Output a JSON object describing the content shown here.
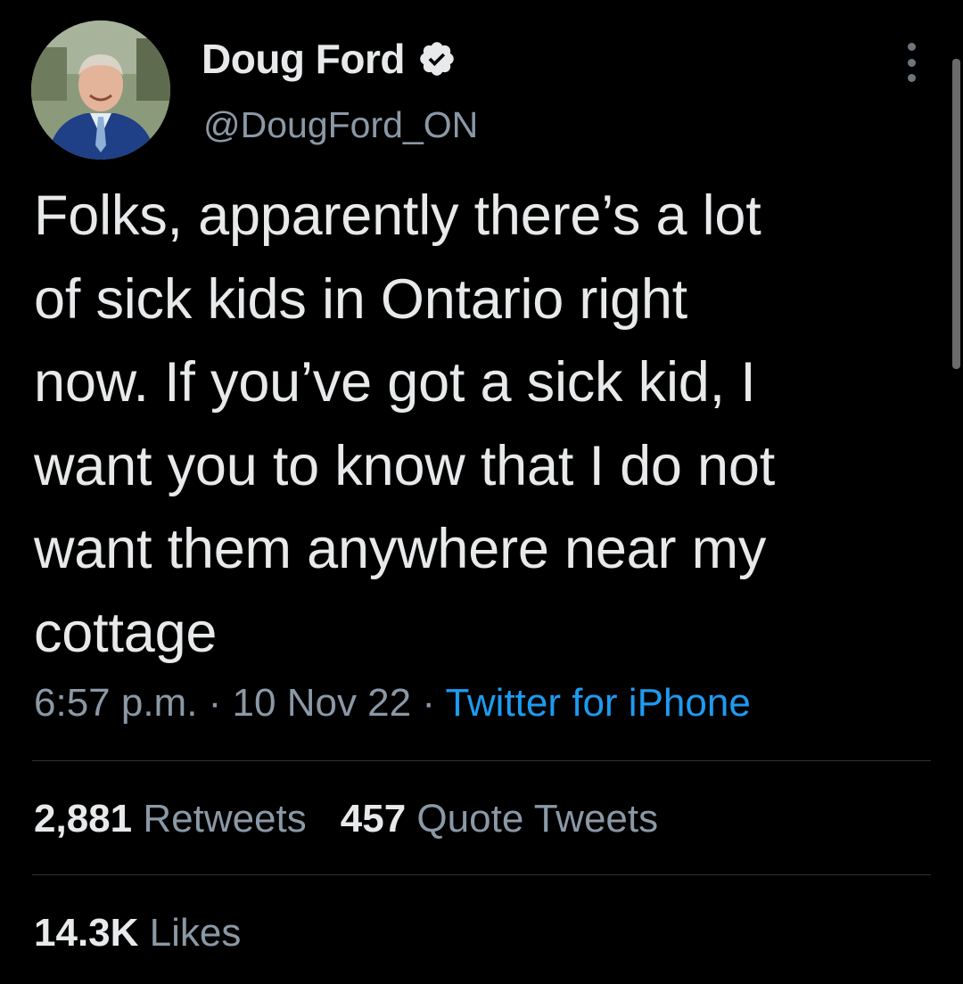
{
  "author": {
    "display_name": "Doug Ford",
    "handle": "@DougFord_ON",
    "verified": true,
    "verified_icon": "verified-badge-icon",
    "avatar_icon": "profile-photo"
  },
  "tweet": {
    "text": "Folks, apparently there’s a lot\nof sick kids in Ontario right\nnow. If you’ve got a sick kid, I\nwant you to know that I do not\nwant them anywhere near my\ncottage"
  },
  "meta": {
    "time": "6:57 p.m.",
    "separator": " · ",
    "date": "10 Nov 22",
    "source": "Twitter for iPhone"
  },
  "stats": {
    "retweets_count": "2,881",
    "retweets_label": "Retweets",
    "quotes_count": "457",
    "quotes_label": "Quote Tweets",
    "likes_count": "14.3K",
    "likes_label": "Likes"
  },
  "colors": {
    "background": "#000000",
    "primary_text": "#e7e9ea",
    "secondary_text": "#8b98a5",
    "link": "#1d9bf0",
    "divider": "#2f3336"
  },
  "icons": {
    "more": "more-options-icon"
  }
}
